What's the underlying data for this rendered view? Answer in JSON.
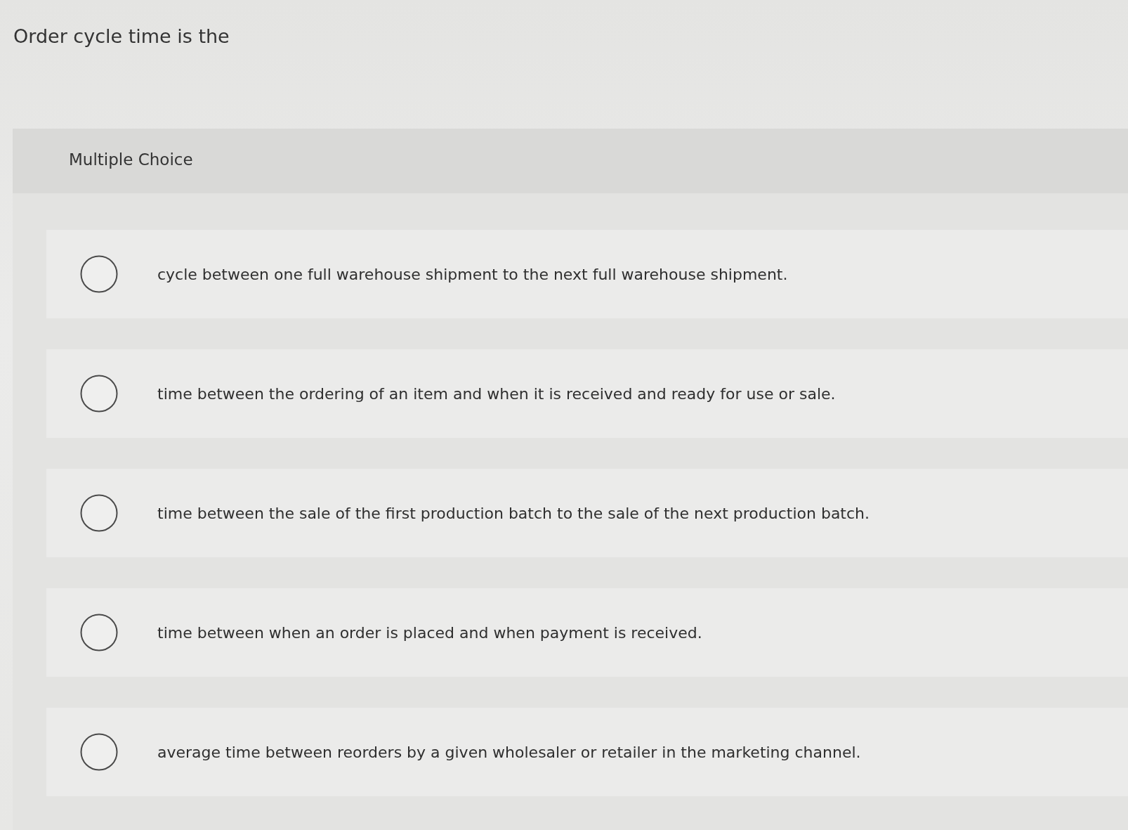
{
  "question": {
    "text": "Order cycle time is the"
  },
  "panel": {
    "heading": "Multiple Choice",
    "choices": [
      {
        "label": "cycle between one full warehouse shipment to the next full warehouse shipment.",
        "selected": false
      },
      {
        "label": "time between the ordering of an item and when it is received and ready for use or sale.",
        "selected": false
      },
      {
        "label": "time between the sale of the first production batch to the sale of the next production batch.",
        "selected": false
      },
      {
        "label": "time between when an order is placed and when payment is received.",
        "selected": false
      },
      {
        "label": "average time between reorders by a given wholesaler or retailer in the marketing channel.",
        "selected": false
      }
    ]
  }
}
